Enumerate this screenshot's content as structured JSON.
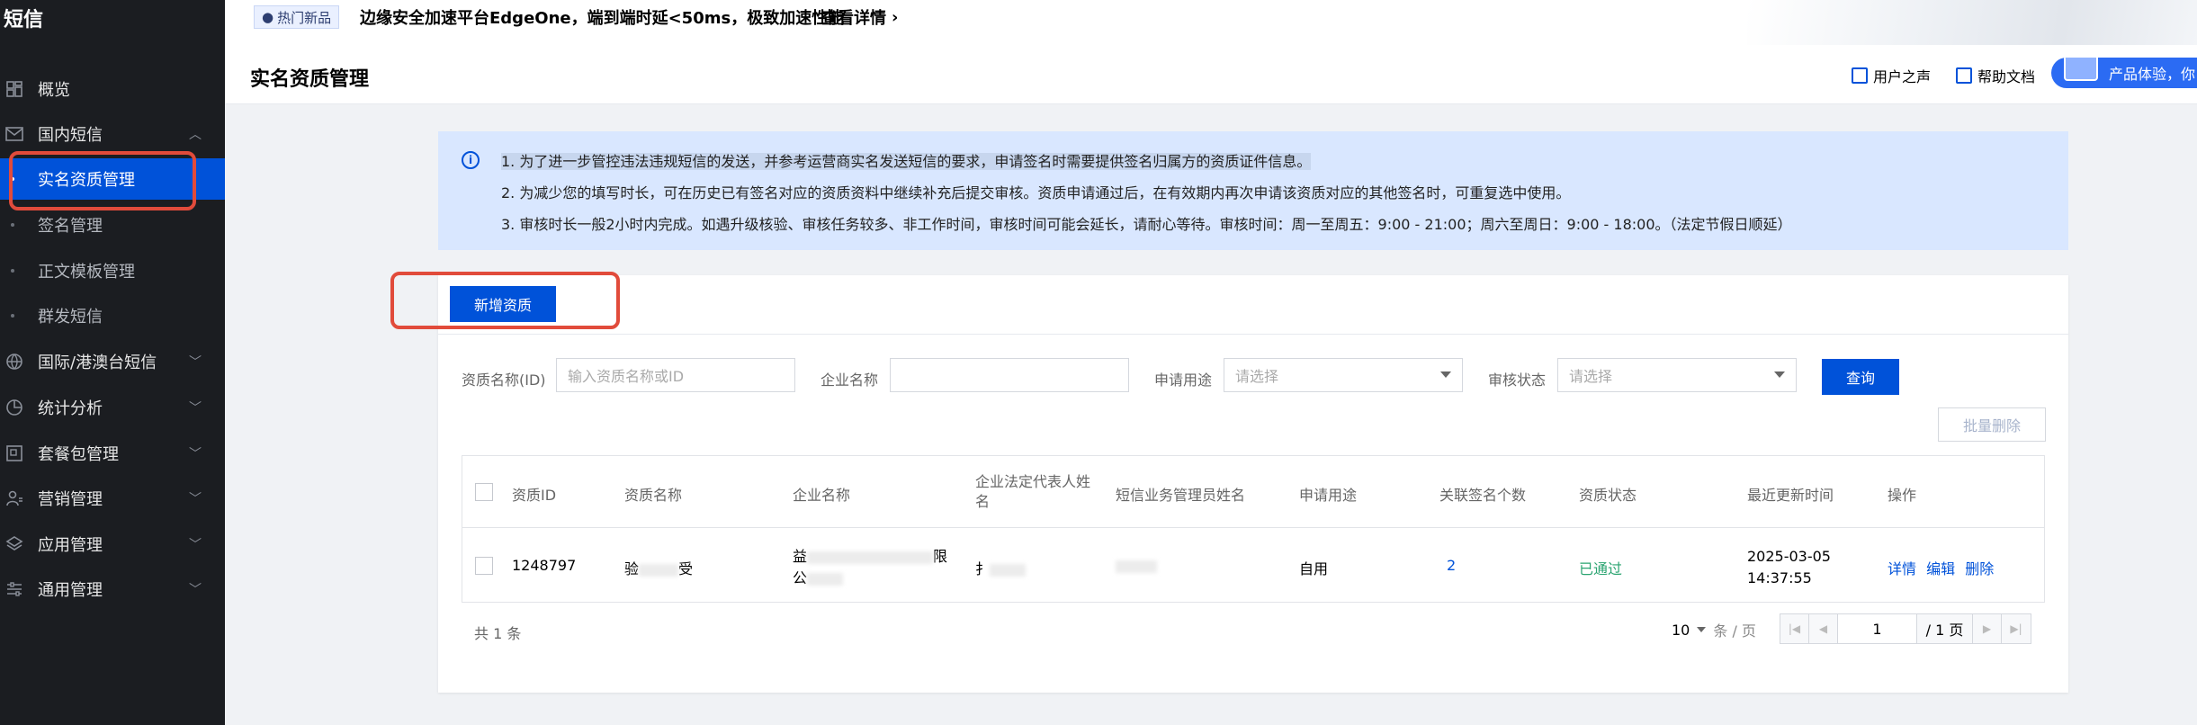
{
  "sidebar": {
    "title": "短信",
    "items": [
      {
        "label": "概览",
        "icon": "dashboard-icon"
      },
      {
        "label": "国内短信",
        "icon": "mail-icon",
        "chevron": "up"
      },
      {
        "label": "实名资质管理",
        "sub": true,
        "active": true
      },
      {
        "label": "签名管理",
        "sub": true
      },
      {
        "label": "正文模板管理",
        "sub": true
      },
      {
        "label": "群发短信",
        "sub": true
      },
      {
        "label": "国际/港澳台短信",
        "icon": "globe-icon",
        "chevron": "down"
      },
      {
        "label": "统计分析",
        "icon": "pie-chart-icon",
        "chevron": "down"
      },
      {
        "label": "套餐包管理",
        "icon": "package-icon",
        "chevron": "down"
      },
      {
        "label": "营销管理",
        "icon": "user-group-icon",
        "chevron": "down"
      },
      {
        "label": "应用管理",
        "icon": "layers-icon",
        "chevron": "down"
      },
      {
        "label": "通用管理",
        "icon": "settings-icon",
        "chevron": "down"
      }
    ]
  },
  "banner": {
    "tag": "热门新品",
    "text": "边缘安全加速平台EdgeOne，端到端时延<50ms，极致加速性能",
    "link": "查看详情"
  },
  "header": {
    "title": "实名资质管理",
    "feedback": "用户之声",
    "docs": "帮助文档",
    "pill": "产品体验，你"
  },
  "info": {
    "lines": [
      "1. 为了进一步管控违法违规短信的发送，并参考运营商实名发送短信的要求，申请签名时需要提供签名归属方的资质证件信息。",
      "2. 为减少您的填写时长，可在历史已有签名对应的资质资料中继续补充后提交审核。资质申请通过后，在有效期内再次申请该资质对应的其他签名时，可重复选中使用。",
      "3. 审核时长一般2小时内完成。如遇升级核验、审核任务较多、非工作时间，审核时间可能会延长，请耐心等待。审核时间：周一至周五：9:00 - 21:00；周六至周日：9:00 - 18:00。（法定节假日顺延）"
    ]
  },
  "card": {
    "add_button": "新增资质",
    "filters": {
      "name_label": "资质名称(ID)",
      "name_placeholder": "输入资质名称或ID",
      "company_label": "企业名称",
      "company_value": "",
      "usage_label": "申请用途",
      "usage_placeholder": "请选择",
      "status_label": "审核状态",
      "status_placeholder": "请选择",
      "query_button": "查询"
    },
    "batch_delete": "批量删除",
    "table": {
      "headers": [
        "资质ID",
        "资质名称",
        "企业名称",
        "企业法定代表人姓名",
        "短信业务管理员姓名",
        "申请用途",
        "关联签名个数",
        "资质状态",
        "最近更新时间",
        "操作"
      ],
      "rows": [
        {
          "id": "1248797",
          "name_a": "验",
          "name_b": "受",
          "company_a": "益",
          "company_b": "限",
          "company_c": "公",
          "legal": "扌",
          "usage": "自用",
          "sign_count": "2",
          "status": "已通过",
          "updated_date": "2025-03-05",
          "updated_time": "14:37:55",
          "actions": [
            "详情",
            "编辑",
            "删除"
          ]
        }
      ]
    },
    "pagination": {
      "total": "共 1 条",
      "page_size": "10",
      "page_size_unit": "条 / 页",
      "current": "1",
      "pages": "/ 1 页"
    }
  },
  "colors": {
    "primary": "#0052d9",
    "sidebar_bg": "#1b1d21",
    "highlight": "#e14b3b",
    "success": "#2ba471"
  }
}
